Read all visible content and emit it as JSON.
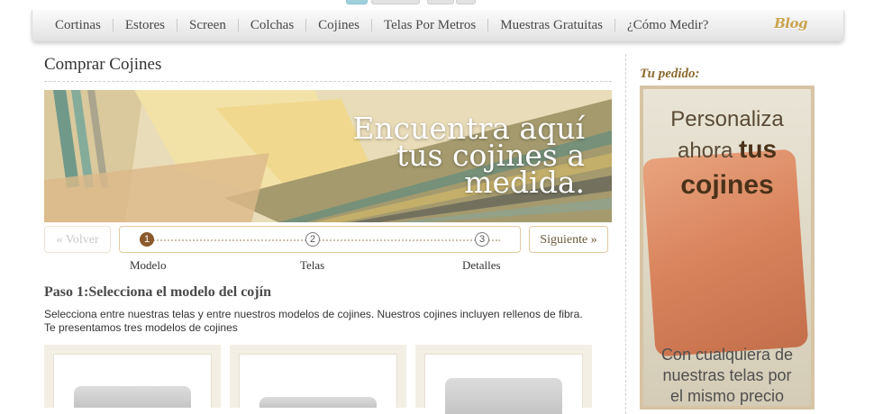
{
  "nav": {
    "items": [
      "Cortinas",
      "Estores",
      "Screen",
      "Colchas",
      "Cojines",
      "Telas Por Metros",
      "Muestras Gratuitas",
      "¿Cómo Medir?"
    ],
    "blog": "Blog"
  },
  "page": {
    "title": "Comprar Cojines"
  },
  "banner": {
    "line1": "Encuentra aquí",
    "line2": "tus cojines a",
    "line3": "medida."
  },
  "steps": {
    "back_label": "« Volver",
    "next_label": "Siguiente »",
    "items": [
      {
        "number": "1",
        "label": "Modelo"
      },
      {
        "number": "2",
        "label": "Telas"
      },
      {
        "number": "3",
        "label": "Detalles"
      }
    ]
  },
  "section": {
    "heading": "Paso 1:Selecciona el modelo del cojín",
    "desc_line1": "Selecciona entre nuestras telas y entre nuestros modelos de cojines. Nuestros cojines incluyen rellenos de fibra.",
    "desc_line2": "Te presentamos tres modelos de cojines"
  },
  "sidebar": {
    "title": "Tu pedido:",
    "ad_line1": "Personaliza",
    "ad_line2a": "ahora ",
    "ad_line2b": "tus",
    "ad_line3": "cojines",
    "ad_foot1": "Con cualquiera de",
    "ad_foot2": "nuestras telas por",
    "ad_foot3": "el mismo precio"
  }
}
